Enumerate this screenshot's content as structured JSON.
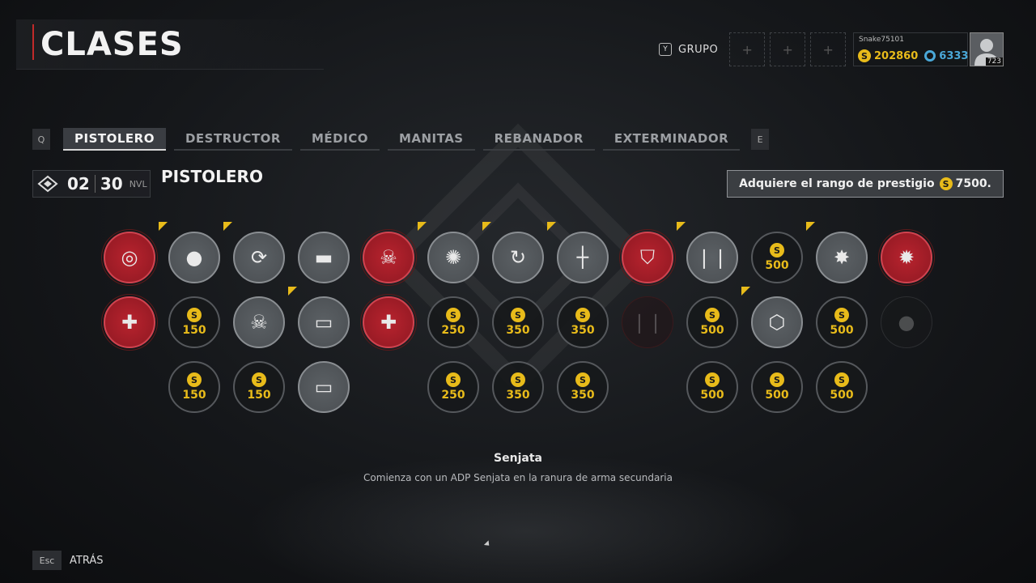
{
  "header": {
    "title": "CLASES",
    "group_key": "Y",
    "group_label": "GRUPO",
    "slots": [
      "+",
      "+",
      "+"
    ],
    "profile": {
      "username": "Snake75101",
      "credits": "202860",
      "parts": "6333",
      "level": "723"
    }
  },
  "tabs": {
    "prev_key": "Q",
    "next_key": "E",
    "items": [
      {
        "label": "PISTOLERO",
        "active": true
      },
      {
        "label": "DESTRUCTOR",
        "active": false
      },
      {
        "label": "MÉDICO",
        "active": false
      },
      {
        "label": "MANITAS",
        "active": false
      },
      {
        "label": "REBANADOR",
        "active": false
      },
      {
        "label": "EXTERMINADOR",
        "active": false
      }
    ]
  },
  "class_header": {
    "rank": "02",
    "level": "30",
    "level_suffix": "NVL",
    "name": "PISTOLERO",
    "prestige_text": "Adquiere el rango de prestigio",
    "prestige_cost": "7500."
  },
  "skills": {
    "currency_symbol": "S",
    "rows": [
      [
        {
          "state": "red",
          "icon": "target-icon"
        },
        {
          "state": "gray",
          "icon": "grenade-icon",
          "flag": true
        },
        {
          "state": "gray",
          "icon": "ammo-swap-icon",
          "flag": true
        },
        {
          "state": "gray",
          "icon": "launcher-icon"
        },
        {
          "state": "red",
          "icon": "skull-icon"
        },
        {
          "state": "gray",
          "icon": "explosion-skull-icon",
          "flag": true
        },
        {
          "state": "gray",
          "icon": "rifle-swap-icon",
          "flag": true
        },
        {
          "state": "gray",
          "icon": "turret-icon",
          "flag": true
        },
        {
          "state": "red",
          "icon": "shield-icon"
        },
        {
          "state": "gray",
          "icon": "magazine-icon",
          "flag": true
        },
        {
          "state": "locked",
          "cost": "500"
        },
        {
          "state": "gray",
          "icon": "blast-icon",
          "flag": true
        },
        {
          "state": "red",
          "icon": "explosion-icon"
        }
      ],
      [
        {
          "state": "red",
          "icon": "ammo-heal-icon"
        },
        {
          "state": "locked",
          "cost": "150"
        },
        {
          "state": "gray",
          "icon": "skull-grenade-icon"
        },
        {
          "state": "gray",
          "icon": "rifle-drop-icon",
          "flag": true
        },
        {
          "state": "red",
          "icon": "ammo-heal-icon"
        },
        {
          "state": "locked",
          "cost": "250"
        },
        {
          "state": "locked",
          "cost": "350"
        },
        {
          "state": "locked",
          "cost": "350"
        },
        {
          "state": "dim",
          "icon": "magazine-icon"
        },
        {
          "state": "locked",
          "cost": "500"
        },
        {
          "state": "gray",
          "icon": "hex-nut-icon",
          "flag": true
        },
        {
          "state": "locked",
          "cost": "500"
        },
        {
          "state": "dim2",
          "icon": "grenade-icon"
        }
      ],
      [
        {
          "state": "none"
        },
        {
          "state": "locked",
          "cost": "150"
        },
        {
          "state": "locked",
          "cost": "150"
        },
        {
          "state": "gray",
          "icon": "rifle-drop-icon"
        },
        {
          "state": "none"
        },
        {
          "state": "locked",
          "cost": "250"
        },
        {
          "state": "locked",
          "cost": "350"
        },
        {
          "state": "locked",
          "cost": "350"
        },
        {
          "state": "none"
        },
        {
          "state": "locked",
          "cost": "500"
        },
        {
          "state": "locked",
          "cost": "500"
        },
        {
          "state": "locked",
          "cost": "500"
        },
        {
          "state": "none"
        }
      ]
    ]
  },
  "description": {
    "title": "Senjata",
    "text": "Comienza con un ADP Senjata en la ranura de arma secundaria"
  },
  "footer": {
    "back_key": "Esc",
    "back_label": "ATRÁS"
  },
  "colors": {
    "accent_red": "#b8232e",
    "gold": "#e8bb1a",
    "blue": "#4aa8d8"
  }
}
